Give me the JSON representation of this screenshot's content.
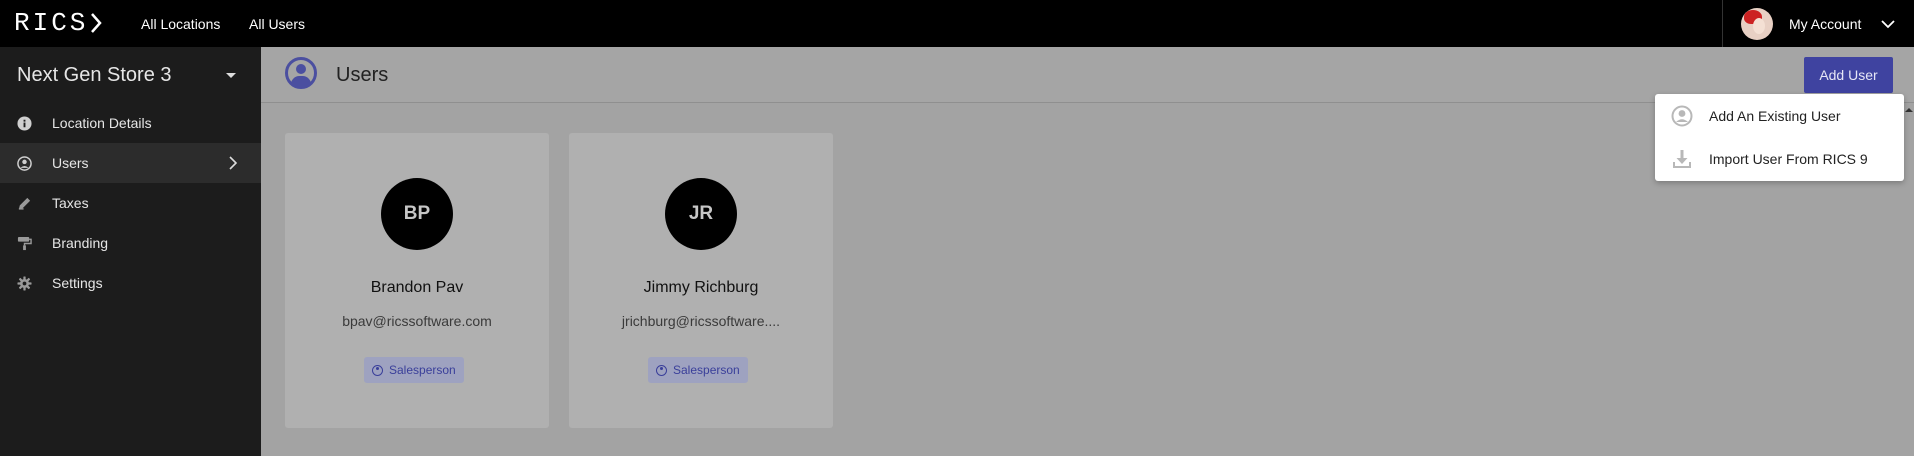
{
  "topbar": {
    "logo": "RICS",
    "nav": [
      "All Locations",
      "All Users"
    ],
    "account_label": "My Account"
  },
  "sidebar": {
    "store_name": "Next Gen Store 3",
    "items": [
      {
        "label": "Location Details",
        "icon": "info-icon"
      },
      {
        "label": "Users",
        "icon": "user-circle-icon",
        "active": true
      },
      {
        "label": "Taxes",
        "icon": "pencil-icon"
      },
      {
        "label": "Branding",
        "icon": "paint-roller-icon"
      },
      {
        "label": "Settings",
        "icon": "gear-icon"
      }
    ]
  },
  "header": {
    "title": "Users",
    "add_user_label": "Add User"
  },
  "dropdown": {
    "items": [
      {
        "label": "Add An Existing User",
        "icon": "user-circle-icon"
      },
      {
        "label": "Import User From RICS 9",
        "icon": "download-icon"
      }
    ]
  },
  "users": [
    {
      "initials": "BP",
      "name": "Brandon Pav",
      "email": "bpav@ricssoftware.com",
      "role": "Salesperson"
    },
    {
      "initials": "JR",
      "name": "Jimmy Richburg",
      "email": "jrichburg@ricssoftware....",
      "role": "Salesperson"
    }
  ],
  "colors": {
    "accent": "#3f43a0",
    "sidebar_bg": "#1c1c1c",
    "topbar_bg": "#000000",
    "overlay_bg": "#a3a3a3"
  }
}
